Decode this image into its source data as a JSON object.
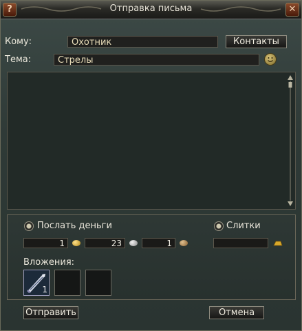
{
  "window": {
    "title": "Отправка письма",
    "help_icon": "question-icon",
    "close_icon": "close-icon"
  },
  "to": {
    "label": "Кому:",
    "value": "Охотник",
    "contacts_button": "Контакты"
  },
  "subject": {
    "label": "Тема:",
    "value": "Стрелы",
    "emote_icon": "smiley-icon"
  },
  "message": {
    "value": ""
  },
  "money": {
    "label": "Послать деньги",
    "gold": "1",
    "silver": "23",
    "copper": "1"
  },
  "bullion": {
    "label": "Слитки",
    "value": ""
  },
  "attachments": {
    "label": "Вложения:",
    "slots": [
      {
        "icon": "arrows-icon",
        "count": "1"
      },
      {
        "icon": "",
        "count": ""
      },
      {
        "icon": "",
        "count": ""
      }
    ]
  },
  "buttons": {
    "send": "Отправить",
    "cancel": "Отмена"
  },
  "colors": {
    "gold": "#d4a22a",
    "silver": "#b8b8b8",
    "copper": "#b08a5a",
    "background": "#323c39"
  }
}
